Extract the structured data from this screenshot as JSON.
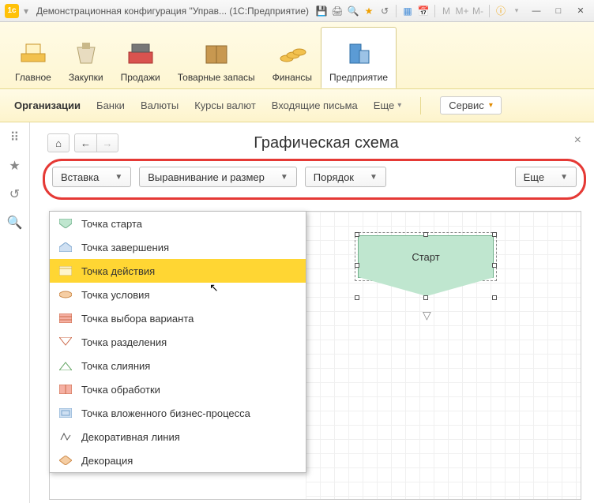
{
  "titlebar": {
    "app_name": "Демонстрационная конфигурация \"Управ...",
    "suffix": "(1С:Предприятие)"
  },
  "ribbon": {
    "items": [
      {
        "label": "Главное"
      },
      {
        "label": "Закупки"
      },
      {
        "label": "Продажи"
      },
      {
        "label": "Товарные запасы"
      },
      {
        "label": "Финансы"
      },
      {
        "label": "Предприятие"
      }
    ]
  },
  "subnav": {
    "items": [
      {
        "label": "Организации",
        "bold": true
      },
      {
        "label": "Банки"
      },
      {
        "label": "Валюты"
      },
      {
        "label": "Курсы валют"
      },
      {
        "label": "Входящие письма"
      }
    ],
    "more": "Еще",
    "service": "Сервис"
  },
  "page": {
    "title": "Графическая схема"
  },
  "toolbar": {
    "insert": "Вставка",
    "align": "Выравнивание и размер",
    "order": "Порядок",
    "more": "Еще"
  },
  "menu": {
    "items": [
      "Точка старта",
      "Точка завершения",
      "Точка действия",
      "Точка условия",
      "Точка выбора варианта",
      "Точка разделения",
      "Точка слияния",
      "Точка обработки",
      "Точка вложенного бизнес-процесса",
      "Декоративная линия",
      "Декорация"
    ],
    "highlighted_index": 2
  },
  "shape": {
    "label": "Старт"
  }
}
